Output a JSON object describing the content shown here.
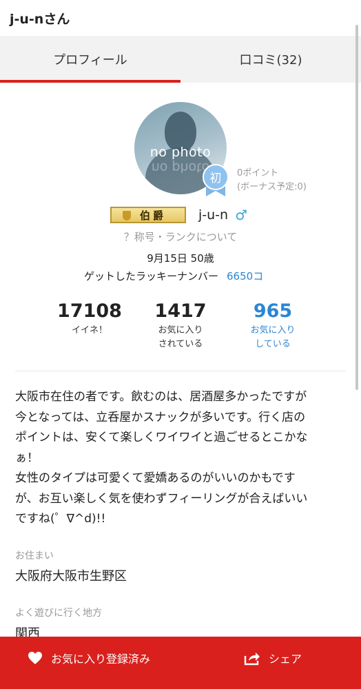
{
  "header": {
    "title": "j-u-nさん"
  },
  "tabs": [
    {
      "label": "プロフィール",
      "active": true
    },
    {
      "label": "口コミ(32)",
      "active": false
    }
  ],
  "avatar": {
    "placeholder_text": "no photo"
  },
  "badge": {
    "first_label": "初"
  },
  "points": {
    "current": "0ポイント",
    "bonus": "(ボーナス予定:0)"
  },
  "rank": {
    "title": "伯爵"
  },
  "user": {
    "name": "j-u-n",
    "gender_icon": "male-icon"
  },
  "rank_link": {
    "label": "？称号・ランクについて"
  },
  "profile": {
    "birthday_age": "9月15日 50歳",
    "lucky_label": "ゲットしたラッキーナンバー",
    "lucky_value": "6650コ"
  },
  "stats": [
    {
      "value": "17108",
      "label_line1": "イイネ！",
      "label_line2": ""
    },
    {
      "value": "1417",
      "label_line1": "お気に入り",
      "label_line2": "されている"
    },
    {
      "value": "965",
      "label_line1": "お気に入り",
      "label_line2": "している"
    }
  ],
  "bio": {
    "lines": [
      "大阪市在住の者です。飲むのは、居酒屋多かったですが",
      "今となっては、立呑屋かスナックが多いです。行く店の",
      "ポイントは、安くて楽しくワイワイと過ごせるとこかな",
      "ぁ！",
      "女性のタイプは可愛くて愛嬌あるのがいいのかもです",
      "が、お互い楽しく気を使わずフィーリングが合えばいい",
      "ですね(゜∇^d)!!"
    ]
  },
  "fields": {
    "residence_label": "お住まい",
    "residence_value": "大阪府大阪市生野区",
    "area_label": "よく遊びに行く地方",
    "area_value": "関西"
  },
  "actions": {
    "favorite_label": "お気に入り登録済み",
    "share_label": "シェア"
  },
  "colors": {
    "accent_red": "#d9201d",
    "link_blue": "#2a86d4",
    "male_blue": "#3aa6d4",
    "muted_gray": "#999999"
  }
}
